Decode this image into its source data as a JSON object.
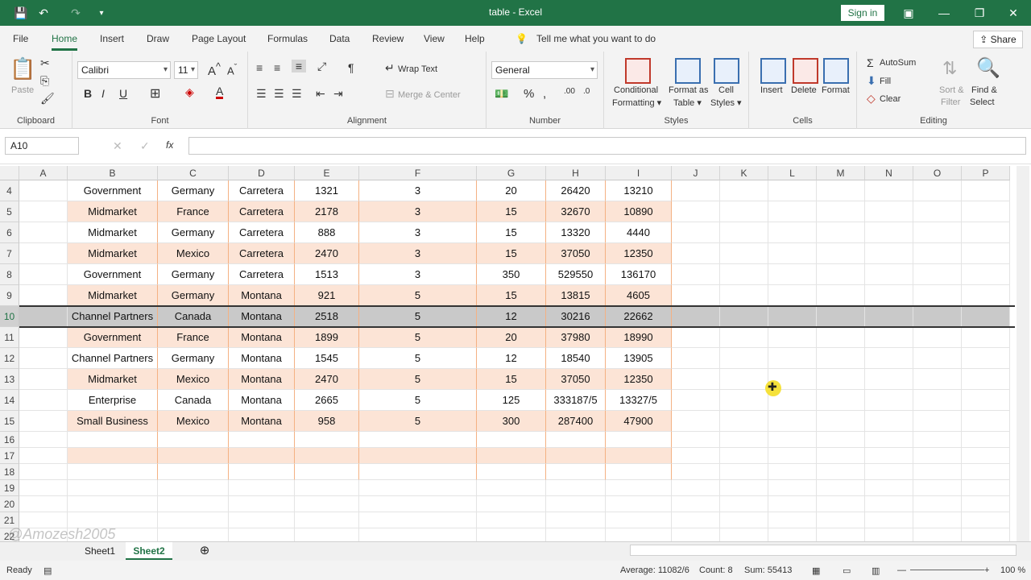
{
  "titlebar": {
    "title": "table  -  Excel",
    "signin": "Sign in"
  },
  "tabs": [
    "File",
    "Home",
    "Insert",
    "Draw",
    "Page Layout",
    "Formulas",
    "Data",
    "Review",
    "View",
    "Help"
  ],
  "tell_me": "Tell me what you want to do",
  "share": "Share",
  "ribbon": {
    "clipboard": {
      "label": "Clipboard",
      "paste": "Paste"
    },
    "font": {
      "label": "Font",
      "name": "Calibri",
      "size": "11"
    },
    "alignment": {
      "label": "Alignment",
      "wrap": "Wrap Text",
      "merge": "Merge & Center"
    },
    "number": {
      "label": "Number",
      "format": "General"
    },
    "styles": {
      "label": "Styles",
      "conditional1": "Conditional",
      "conditional2": "Formatting ▾",
      "format1": "Format as",
      "format2": "Table ▾",
      "cell1": "Cell",
      "cell2": "Styles ▾"
    },
    "cells": {
      "label": "Cells",
      "insert": "Insert",
      "delete": "Delete",
      "format": "Format"
    },
    "editing": {
      "label": "Editing",
      "autosum": "AutoSum",
      "fill": "Fill",
      "clear": "Clear",
      "sort1": "Sort &",
      "sort2": "Filter",
      "find1": "Find &",
      "find2": "Select"
    }
  },
  "namebox": "A10",
  "fx": "fx",
  "columns": [
    "A",
    "B",
    "C",
    "D",
    "E",
    "F",
    "G",
    "H",
    "I",
    "J",
    "K",
    "L",
    "M",
    "N",
    "O",
    "P"
  ],
  "rows": [
    {
      "n": "4",
      "cells": [
        "Government",
        "Germany",
        "Carretera",
        "1321",
        "3",
        "20",
        "26420",
        "13210"
      ]
    },
    {
      "n": "5",
      "cells": [
        "Midmarket",
        "France",
        "Carretera",
        "2178",
        "3",
        "15",
        "32670",
        "10890"
      ]
    },
    {
      "n": "6",
      "cells": [
        "Midmarket",
        "Germany",
        "Carretera",
        "888",
        "3",
        "15",
        "13320",
        "4440"
      ]
    },
    {
      "n": "7",
      "cells": [
        "Midmarket",
        "Mexico",
        "Carretera",
        "2470",
        "3",
        "15",
        "37050",
        "12350"
      ]
    },
    {
      "n": "8",
      "cells": [
        "Government",
        "Germany",
        "Carretera",
        "1513",
        "3",
        "350",
        "529550",
        "136170"
      ]
    },
    {
      "n": "9",
      "cells": [
        "Midmarket",
        "Germany",
        "Montana",
        "921",
        "5",
        "15",
        "13815",
        "4605"
      ]
    },
    {
      "n": "10",
      "cells": [
        "Channel Partners",
        "Canada",
        "Montana",
        "2518",
        "5",
        "12",
        "30216",
        "22662"
      ]
    },
    {
      "n": "11",
      "cells": [
        "Government",
        "France",
        "Montana",
        "1899",
        "5",
        "20",
        "37980",
        "18990"
      ]
    },
    {
      "n": "12",
      "cells": [
        "Channel Partners",
        "Germany",
        "Montana",
        "1545",
        "5",
        "12",
        "18540",
        "13905"
      ]
    },
    {
      "n": "13",
      "cells": [
        "Midmarket",
        "Mexico",
        "Montana",
        "2470",
        "5",
        "15",
        "37050",
        "12350"
      ]
    },
    {
      "n": "14",
      "cells": [
        "Enterprise",
        "Canada",
        "Montana",
        "2665",
        "5",
        "125",
        "333187/5",
        "13327/5"
      ]
    },
    {
      "n": "15",
      "cells": [
        "Small Business",
        "Mexico",
        "Montana",
        "958",
        "5",
        "300",
        "287400",
        "47900"
      ]
    },
    {
      "n": "16",
      "cells": [
        "",
        "",
        "",
        "",
        "",
        "",
        "",
        ""
      ]
    },
    {
      "n": "17",
      "cells": [
        "",
        "",
        "",
        "",
        "",
        "",
        "",
        ""
      ]
    },
    {
      "n": "18",
      "cells": [
        "",
        "",
        "",
        "",
        "",
        "",
        "",
        ""
      ]
    },
    {
      "n": "19",
      "cells": []
    },
    {
      "n": "20",
      "cells": []
    },
    {
      "n": "21",
      "cells": []
    },
    {
      "n": "22",
      "cells": []
    }
  ],
  "sheets": [
    "Sheet1",
    "Sheet2"
  ],
  "status": {
    "ready": "Ready",
    "average": "Average: 11082/6",
    "count": "Count: 8",
    "sum": "Sum: 55413",
    "zoom": "100 %"
  },
  "watermark": "@Amozesh2005"
}
